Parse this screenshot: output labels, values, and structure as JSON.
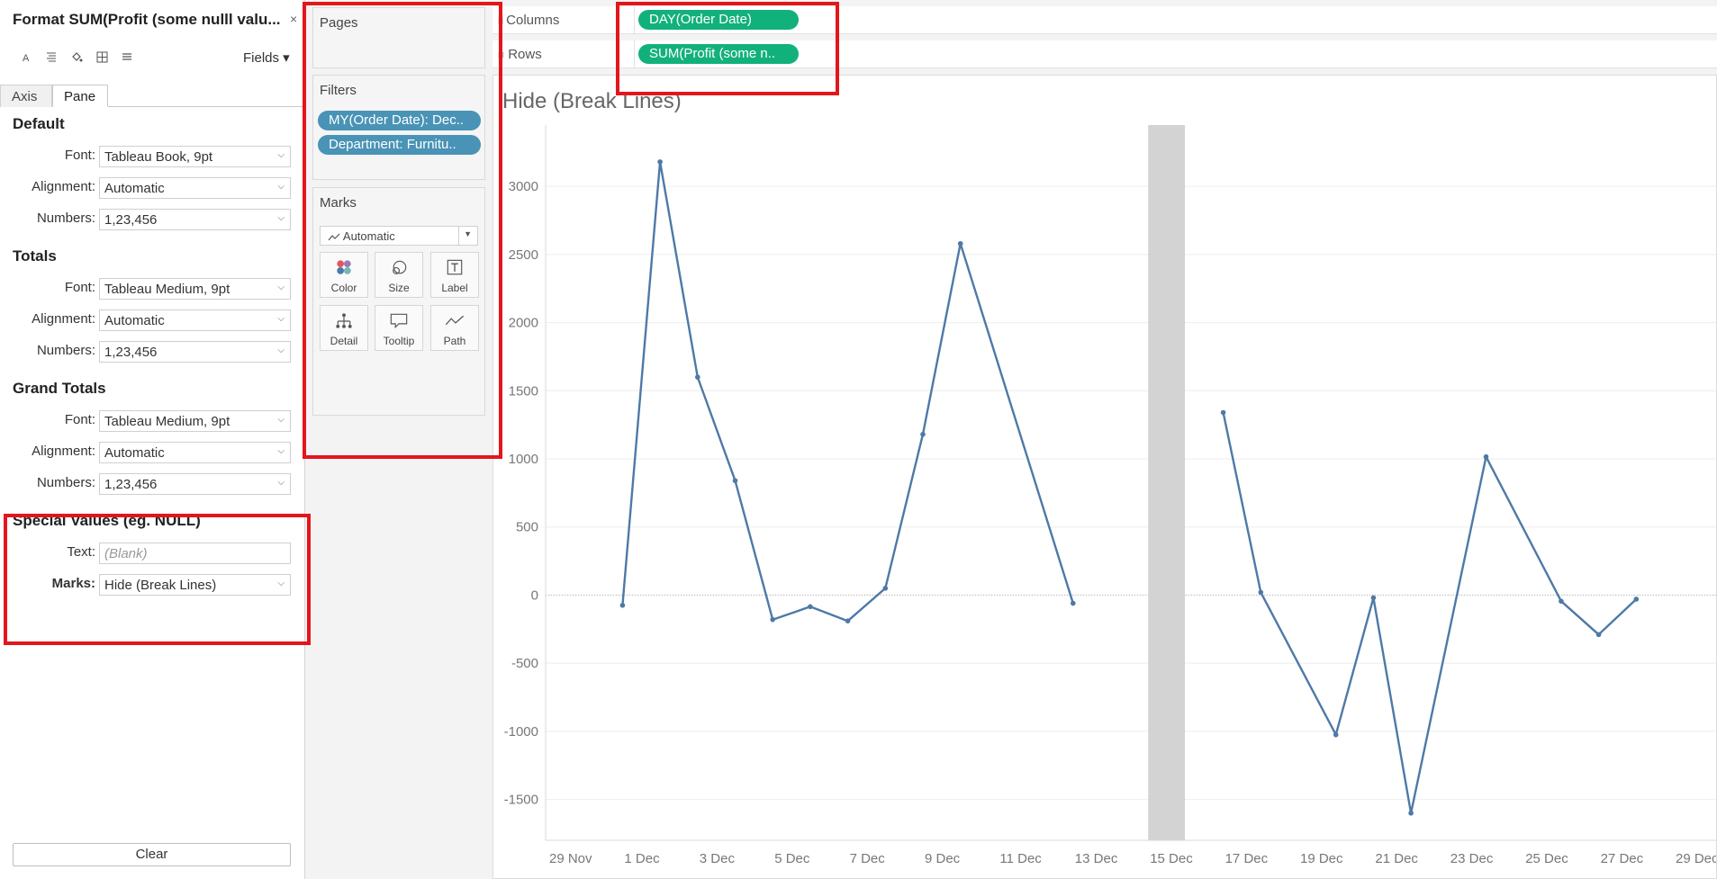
{
  "format_panel": {
    "title": "Format SUM(Profit (some nulll valu...",
    "close": "×",
    "toolbar_icons": [
      "font-icon",
      "align-icon",
      "shading-icon",
      "borders-icon",
      "lines-icon"
    ],
    "fields_label": "Fields ▾",
    "tabs": [
      {
        "label": "Axis"
      },
      {
        "label": "Pane"
      }
    ],
    "sections": {
      "default": {
        "heading": "Default",
        "font_label": "Font:",
        "font_value": "Tableau Book, 9pt",
        "alignment_label": "Alignment:",
        "alignment_value": "Automatic",
        "numbers_label": "Numbers:",
        "numbers_value": "1,23,456"
      },
      "totals": {
        "heading": "Totals",
        "font_label": "Font:",
        "font_value": "Tableau Medium, 9pt",
        "alignment_label": "Alignment:",
        "alignment_value": "Automatic",
        "numbers_label": "Numbers:",
        "numbers_value": "1,23,456"
      },
      "grand_totals": {
        "heading": "Grand Totals",
        "font_label": "Font:",
        "font_value": "Tableau Medium, 9pt",
        "alignment_label": "Alignment:",
        "alignment_value": "Automatic",
        "numbers_label": "Numbers:",
        "numbers_value": "1,23,456"
      },
      "special_values": {
        "heading": "Special Values (eg. NULL)",
        "text_label": "Text:",
        "text_placeholder": "(Blank)",
        "marks_label": "Marks:",
        "marks_value": "Hide (Break Lines)"
      }
    },
    "clear_label": "Clear"
  },
  "cards": {
    "pages": {
      "title": "Pages"
    },
    "filters": {
      "title": "Filters",
      "pills": [
        "MY(Order Date): Dec..",
        "Department: Furnitu.."
      ]
    },
    "marks": {
      "title": "Marks",
      "type": "Automatic",
      "buttons": [
        {
          "label": "Color",
          "icon": "color-icon"
        },
        {
          "label": "Size",
          "icon": "size-icon"
        },
        {
          "label": "Label",
          "icon": "label-icon"
        },
        {
          "label": "Detail",
          "icon": "detail-icon"
        },
        {
          "label": "Tooltip",
          "icon": "tooltip-icon"
        },
        {
          "label": "Path",
          "icon": "path-icon"
        }
      ]
    }
  },
  "shelves": {
    "columns": {
      "label": "Columns",
      "pill": "DAY(Order Date)"
    },
    "rows": {
      "label": "Rows",
      "pill": "SUM(Profit (some n.."
    }
  },
  "colors": {
    "line": "#4e79a7",
    "pill_green": "#12b17c",
    "pill_blue": "#4993b6",
    "highlight": "#e3161b",
    "band": "#d3d3d3"
  },
  "chart_data": {
    "type": "line",
    "title": "Hide (Break Lines)",
    "xlabel": "",
    "ylabel": "",
    "ylim": [
      -1800,
      3450
    ],
    "xlim": [
      "29 Nov",
      "30 Dec"
    ],
    "x_tick_labels": [
      "29 Nov",
      "1 Dec",
      "3 Dec",
      "5 Dec",
      "7 Dec",
      "9 Dec",
      "11 Dec",
      "13 Dec",
      "15 Dec",
      "17 Dec",
      "19 Dec",
      "21 Dec",
      "23 Dec",
      "25 Dec",
      "27 Dec",
      "29 Dec"
    ],
    "y_ticks": [
      -1500,
      -1000,
      -500,
      0,
      500,
      1000,
      1500,
      2000,
      2500,
      3000
    ],
    "gridlines": true,
    "null_band": {
      "x": "15 Dec"
    },
    "series": [
      {
        "segments": [
          [
            {
              "x": "1 Dec",
              "y": -75
            },
            {
              "x": "2 Dec",
              "y": 3180
            },
            {
              "x": "3 Dec",
              "y": 1600
            },
            {
              "x": "4 Dec",
              "y": 840
            },
            {
              "x": "5 Dec",
              "y": -180
            },
            {
              "x": "6 Dec",
              "y": -85
            },
            {
              "x": "7 Dec",
              "y": -190
            },
            {
              "x": "8 Dec",
              "y": 50
            },
            {
              "x": "9 Dec",
              "y": 1180
            },
            {
              "x": "10 Dec",
              "y": 2580
            },
            {
              "x": "13 Dec",
              "y": -60
            }
          ],
          [
            {
              "x": "17 Dec",
              "y": 1340
            },
            {
              "x": "18 Dec",
              "y": 20
            },
            {
              "x": "20 Dec",
              "y": -1025
            },
            {
              "x": "21 Dec",
              "y": -20
            },
            {
              "x": "22 Dec",
              "y": -1600
            },
            {
              "x": "24 Dec",
              "y": 1015
            },
            {
              "x": "26 Dec",
              "y": -45
            },
            {
              "x": "27 Dec",
              "y": -290
            },
            {
              "x": "28 Dec",
              "y": -30
            }
          ]
        ]
      }
    ]
  }
}
